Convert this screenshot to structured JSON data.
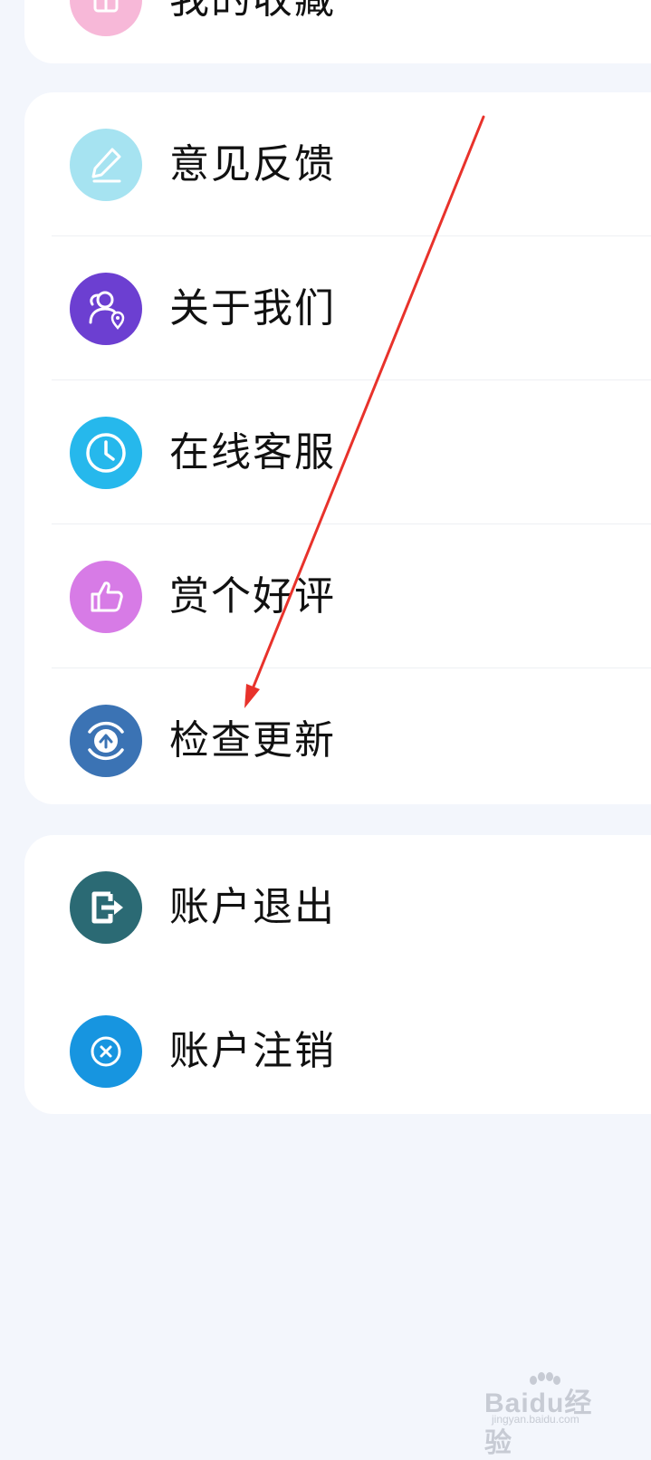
{
  "sections": {
    "top": {
      "item_label": "我的收藏"
    },
    "main": {
      "items": [
        {
          "label": "意见反馈",
          "icon": "pencil-icon",
          "color": "#a6e3f1"
        },
        {
          "label": "关于我们",
          "icon": "users-location-icon",
          "color": "#6c3fd1"
        },
        {
          "label": "在线客服",
          "icon": "clock-icon",
          "color": "#26b8ec"
        },
        {
          "label": "赏个好评",
          "icon": "thumbs-up-icon",
          "color": "#d77be6"
        },
        {
          "label": "检查更新",
          "icon": "upload-arrow-icon",
          "color": "#3b73b4"
        }
      ]
    },
    "account": {
      "items": [
        {
          "label": "账户退出",
          "icon": "exit-icon",
          "color": "#2b6a74"
        },
        {
          "label": "账户注销",
          "icon": "close-circle-icon",
          "color": "#1795e0"
        }
      ]
    }
  },
  "annotation": {
    "color": "#e8322b"
  },
  "watermark": {
    "brand": "Baidu经验",
    "url": "jingyan.baidu.com"
  }
}
